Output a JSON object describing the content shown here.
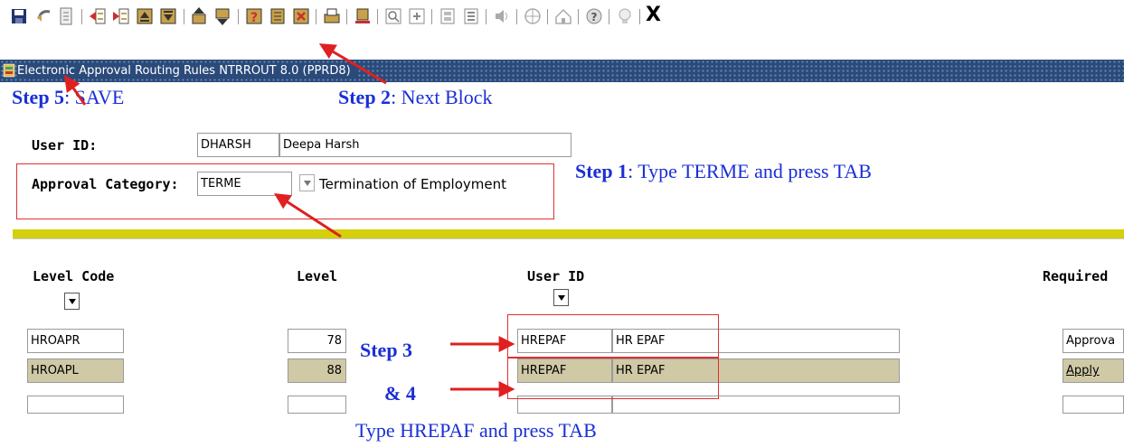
{
  "toolbar": {
    "icons": [
      "save-icon",
      "rollback-icon",
      "select-icon",
      "insert-record-icon",
      "remove-record-icon",
      "previous-record-icon",
      "next-record-icon",
      "previous-block-icon",
      "next-block-icon",
      "query-icon",
      "execute-query-icon",
      "cancel-query-icon",
      "print-icon",
      "export-icon",
      "search-icon",
      "options-icon",
      "form-icon",
      "list-icon",
      "audio-icon",
      "navigator-icon",
      "online-help-icon",
      "help-icon",
      "idea-icon"
    ],
    "exit_label": "X"
  },
  "window": {
    "title": "Electronic Approval Routing Rules  NTRROUT  8.0  (PPRD8)"
  },
  "annotations": {
    "step5_bold": "Step 5",
    "step5_text": ": SAVE",
    "step2_bold": "Step 2",
    "step2_text": ": Next Block",
    "step1_bold": "Step 1",
    "step1_text": ": Type TERME and press TAB",
    "step3_bold": "Step 3",
    "step4_bold": "& 4",
    "bottom_text": "Type HREPAF and press TAB"
  },
  "key_block": {
    "user_id_label": "User ID:",
    "user_id_value": "DHARSH",
    "user_name": "Deepa Harsh",
    "category_label": "Approval Category:",
    "category_value": "TERME",
    "category_desc": "Termination of Employment"
  },
  "grid": {
    "headers": {
      "level_code": "Level Code",
      "level": "Level",
      "user_id": "User ID",
      "required": "Required"
    },
    "rows": [
      {
        "level_code": "HROAPR",
        "level": "78",
        "user_id": "HREPAF",
        "user_name": "HR EPAF",
        "required": "Approva"
      },
      {
        "level_code": "HROAPL",
        "level": "88",
        "user_id": "HREPAF",
        "user_name": "HR EPAF",
        "required": "Apply"
      },
      {
        "level_code": "",
        "level": "",
        "user_id": "",
        "user_name": "",
        "required": ""
      }
    ]
  },
  "colors": {
    "annotation_blue": "#1a2fd6",
    "arrow_red": "#e02020",
    "title_bar": "#2a4a7a",
    "current_record": "#cfc9a6",
    "block_separator": "#d4d00e"
  }
}
